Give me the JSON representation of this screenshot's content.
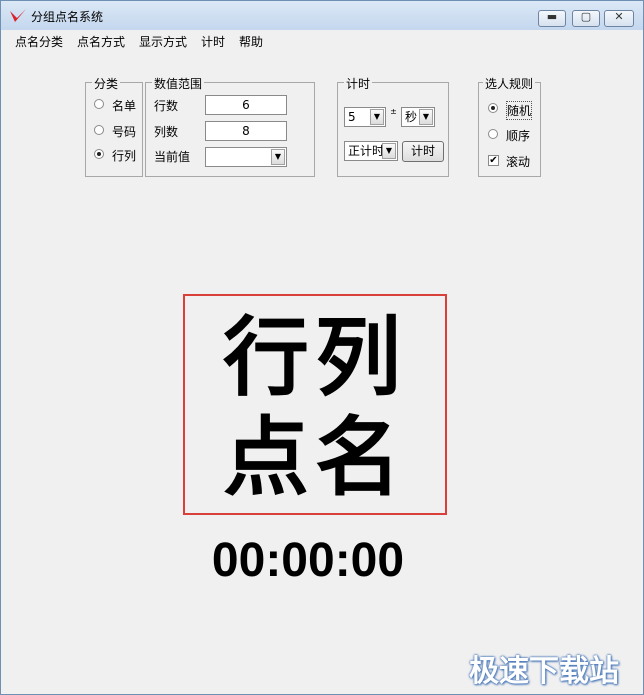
{
  "window": {
    "title": "分组点名系统",
    "controls": {
      "min": "▬",
      "max": "▢",
      "close": "✕"
    }
  },
  "menu": [
    "点名分类",
    "点名方式",
    "显示方式",
    "计时",
    "帮助"
  ],
  "category": {
    "legend": "分类",
    "options": [
      {
        "label": "名单",
        "selected": false
      },
      {
        "label": "号码",
        "selected": false
      },
      {
        "label": "行列",
        "selected": true
      }
    ]
  },
  "range": {
    "legend": "数值范围",
    "rows_label": "行数",
    "rows_value": "6",
    "cols_label": "列数",
    "cols_value": "8",
    "current_label": "当前值",
    "current_value": ""
  },
  "timer_panel": {
    "legend": "计时",
    "amount": "5",
    "spin_up": "±",
    "unit": "秒",
    "mode": "正计时",
    "button": "计时"
  },
  "rules": {
    "legend": "选人规则",
    "options": [
      {
        "label": "随机",
        "selected": true
      },
      {
        "label": "顺序",
        "selected": false
      }
    ],
    "scroll_label": "滚动",
    "scroll_checked": true,
    "check_mark": "✔"
  },
  "display": {
    "line1": "行列",
    "line2": "点名"
  },
  "timer_readout": "00:00:00",
  "watermark": "极速下载站",
  "colors": {
    "display_border": "#d9403a",
    "logo": "#d9232d"
  }
}
